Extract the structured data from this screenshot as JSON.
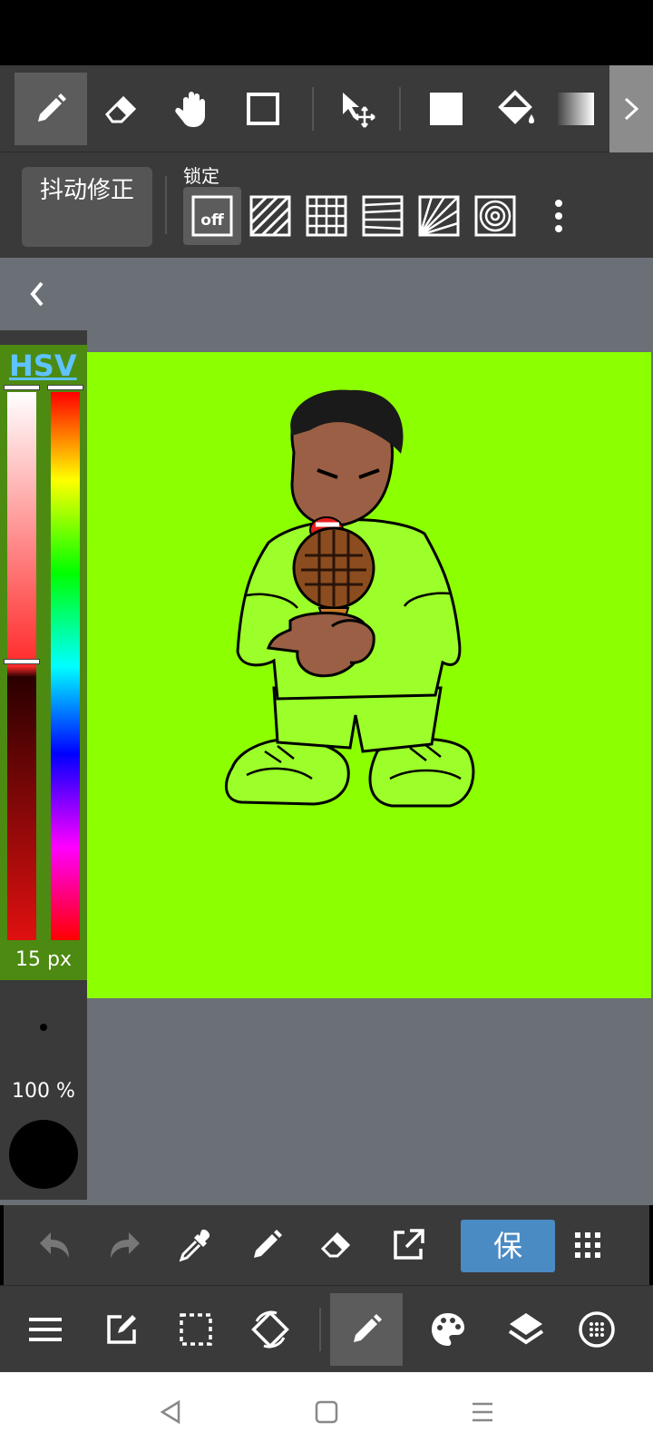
{
  "toolbar": {
    "stabilizer_label": "抖动修正",
    "lock_label": "锁定",
    "snap_off_label": "off"
  },
  "canvas": {
    "background_color": "#8cff00"
  },
  "color_panel": {
    "mode_label": "HSV",
    "brush_size": "15 px",
    "opacity": "100 %",
    "current_color": "#000000"
  },
  "bottom": {
    "save_label": "保"
  },
  "icons": {
    "tools": [
      "pen-icon",
      "eraser-icon",
      "hand-icon",
      "rectangle-icon",
      "move-icon",
      "fill-square-icon",
      "bucket-icon",
      "gradient-icon"
    ],
    "rulers": [
      "snap-off-icon",
      "parallel-lines-icon",
      "grid-icon",
      "horizontal-lines-icon",
      "radial-lines-icon",
      "concentric-icon"
    ],
    "bottom1": [
      "undo-icon",
      "redo-icon",
      "eyedropper-icon",
      "pen-icon",
      "eraser-icon",
      "export-icon",
      "grid-dots-icon"
    ],
    "bottom2": [
      "menu-icon",
      "edit-icon",
      "selection-icon",
      "rotate-icon",
      "pen-icon",
      "palette-icon",
      "layers-icon",
      "material-icon"
    ]
  }
}
